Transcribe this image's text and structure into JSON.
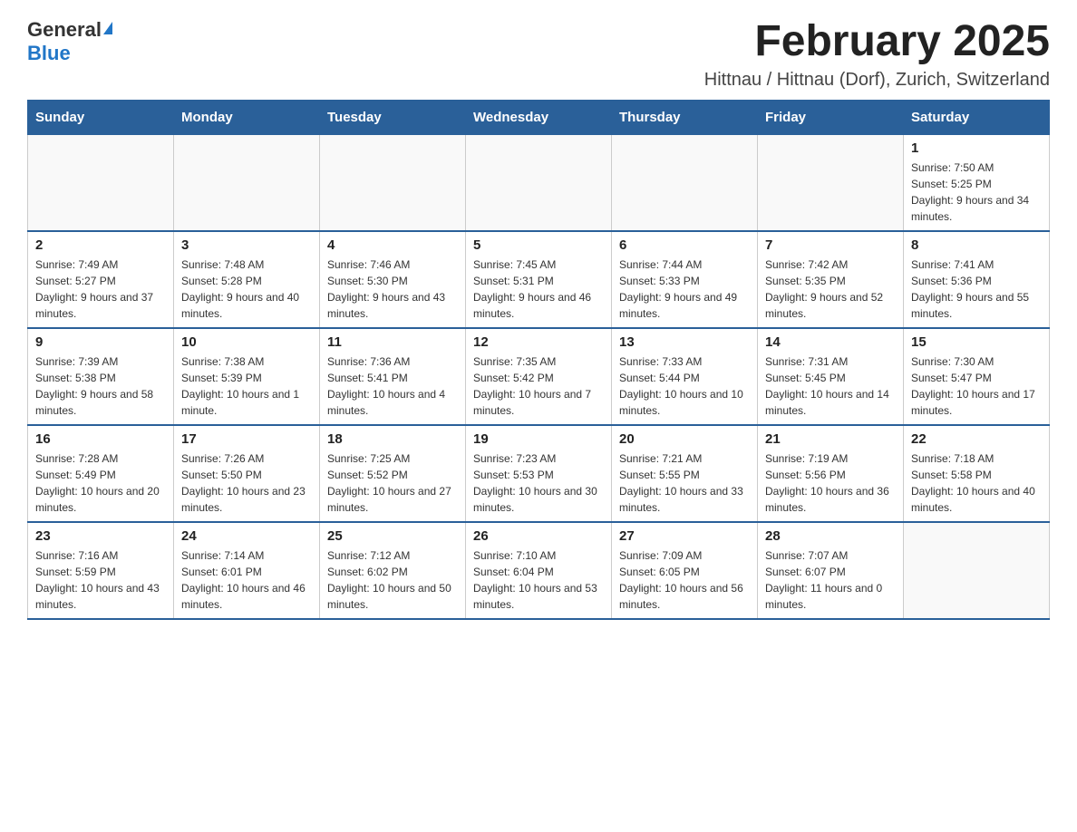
{
  "logo": {
    "general_text": "General",
    "blue_text": "Blue"
  },
  "title": "February 2025",
  "subtitle": "Hittnau / Hittnau (Dorf), Zurich, Switzerland",
  "weekdays": [
    "Sunday",
    "Monday",
    "Tuesday",
    "Wednesday",
    "Thursday",
    "Friday",
    "Saturday"
  ],
  "weeks": [
    [
      {
        "day": "",
        "info": ""
      },
      {
        "day": "",
        "info": ""
      },
      {
        "day": "",
        "info": ""
      },
      {
        "day": "",
        "info": ""
      },
      {
        "day": "",
        "info": ""
      },
      {
        "day": "",
        "info": ""
      },
      {
        "day": "1",
        "info": "Sunrise: 7:50 AM\nSunset: 5:25 PM\nDaylight: 9 hours and 34 minutes."
      }
    ],
    [
      {
        "day": "2",
        "info": "Sunrise: 7:49 AM\nSunset: 5:27 PM\nDaylight: 9 hours and 37 minutes."
      },
      {
        "day": "3",
        "info": "Sunrise: 7:48 AM\nSunset: 5:28 PM\nDaylight: 9 hours and 40 minutes."
      },
      {
        "day": "4",
        "info": "Sunrise: 7:46 AM\nSunset: 5:30 PM\nDaylight: 9 hours and 43 minutes."
      },
      {
        "day": "5",
        "info": "Sunrise: 7:45 AM\nSunset: 5:31 PM\nDaylight: 9 hours and 46 minutes."
      },
      {
        "day": "6",
        "info": "Sunrise: 7:44 AM\nSunset: 5:33 PM\nDaylight: 9 hours and 49 minutes."
      },
      {
        "day": "7",
        "info": "Sunrise: 7:42 AM\nSunset: 5:35 PM\nDaylight: 9 hours and 52 minutes."
      },
      {
        "day": "8",
        "info": "Sunrise: 7:41 AM\nSunset: 5:36 PM\nDaylight: 9 hours and 55 minutes."
      }
    ],
    [
      {
        "day": "9",
        "info": "Sunrise: 7:39 AM\nSunset: 5:38 PM\nDaylight: 9 hours and 58 minutes."
      },
      {
        "day": "10",
        "info": "Sunrise: 7:38 AM\nSunset: 5:39 PM\nDaylight: 10 hours and 1 minute."
      },
      {
        "day": "11",
        "info": "Sunrise: 7:36 AM\nSunset: 5:41 PM\nDaylight: 10 hours and 4 minutes."
      },
      {
        "day": "12",
        "info": "Sunrise: 7:35 AM\nSunset: 5:42 PM\nDaylight: 10 hours and 7 minutes."
      },
      {
        "day": "13",
        "info": "Sunrise: 7:33 AM\nSunset: 5:44 PM\nDaylight: 10 hours and 10 minutes."
      },
      {
        "day": "14",
        "info": "Sunrise: 7:31 AM\nSunset: 5:45 PM\nDaylight: 10 hours and 14 minutes."
      },
      {
        "day": "15",
        "info": "Sunrise: 7:30 AM\nSunset: 5:47 PM\nDaylight: 10 hours and 17 minutes."
      }
    ],
    [
      {
        "day": "16",
        "info": "Sunrise: 7:28 AM\nSunset: 5:49 PM\nDaylight: 10 hours and 20 minutes."
      },
      {
        "day": "17",
        "info": "Sunrise: 7:26 AM\nSunset: 5:50 PM\nDaylight: 10 hours and 23 minutes."
      },
      {
        "day": "18",
        "info": "Sunrise: 7:25 AM\nSunset: 5:52 PM\nDaylight: 10 hours and 27 minutes."
      },
      {
        "day": "19",
        "info": "Sunrise: 7:23 AM\nSunset: 5:53 PM\nDaylight: 10 hours and 30 minutes."
      },
      {
        "day": "20",
        "info": "Sunrise: 7:21 AM\nSunset: 5:55 PM\nDaylight: 10 hours and 33 minutes."
      },
      {
        "day": "21",
        "info": "Sunrise: 7:19 AM\nSunset: 5:56 PM\nDaylight: 10 hours and 36 minutes."
      },
      {
        "day": "22",
        "info": "Sunrise: 7:18 AM\nSunset: 5:58 PM\nDaylight: 10 hours and 40 minutes."
      }
    ],
    [
      {
        "day": "23",
        "info": "Sunrise: 7:16 AM\nSunset: 5:59 PM\nDaylight: 10 hours and 43 minutes."
      },
      {
        "day": "24",
        "info": "Sunrise: 7:14 AM\nSunset: 6:01 PM\nDaylight: 10 hours and 46 minutes."
      },
      {
        "day": "25",
        "info": "Sunrise: 7:12 AM\nSunset: 6:02 PM\nDaylight: 10 hours and 50 minutes."
      },
      {
        "day": "26",
        "info": "Sunrise: 7:10 AM\nSunset: 6:04 PM\nDaylight: 10 hours and 53 minutes."
      },
      {
        "day": "27",
        "info": "Sunrise: 7:09 AM\nSunset: 6:05 PM\nDaylight: 10 hours and 56 minutes."
      },
      {
        "day": "28",
        "info": "Sunrise: 7:07 AM\nSunset: 6:07 PM\nDaylight: 11 hours and 0 minutes."
      },
      {
        "day": "",
        "info": ""
      }
    ]
  ]
}
